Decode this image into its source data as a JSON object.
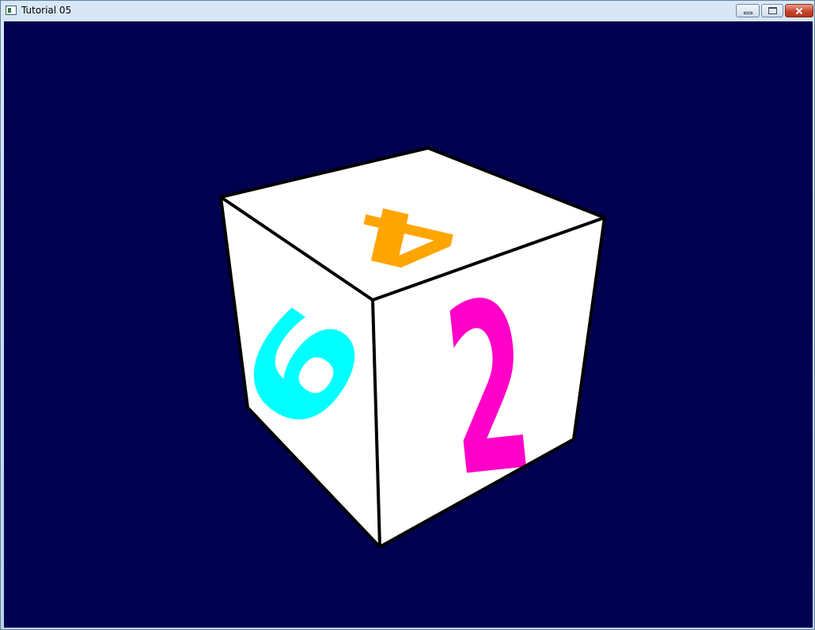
{
  "window": {
    "title": "Tutorial 05",
    "controls": [
      "minimize",
      "maximize",
      "close"
    ]
  },
  "scene": {
    "background_color": "#000050",
    "cube": {
      "face_color": "#ffffff",
      "edge_color": "#000000",
      "faces": {
        "top": {
          "digit": "4",
          "color": "#ffa500"
        },
        "front": {
          "digit": "2",
          "color": "#ff00c8"
        },
        "left": {
          "digit": "6",
          "color": "#00ffff"
        }
      }
    }
  }
}
